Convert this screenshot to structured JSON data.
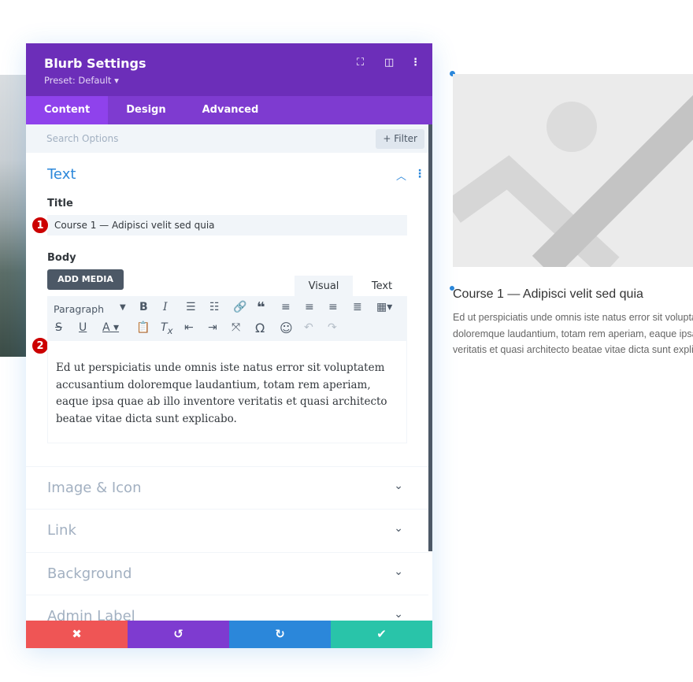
{
  "panel": {
    "title": "Blurb Settings",
    "preset": "Preset: Default ▾",
    "tabs": [
      "Content",
      "Design",
      "Advanced"
    ],
    "search_placeholder": "Search Options",
    "filter_label": "+ Filter",
    "section_title": "Text",
    "title_label": "Title",
    "title_value": "Course 1 — Adipisci velit sed quia",
    "body_label": "Body",
    "add_media": "ADD MEDIA",
    "visual_tab": "Visual",
    "text_tab": "Text",
    "format_select": "Paragraph",
    "body_text": "Ed ut perspiciatis unde omnis iste natus error sit voluptatem accusantium doloremque laudantium, totam rem aperiam, eaque ipsa quae ab illo inventore veritatis et quasi architecto beatae vitae dicta sunt explicabo.",
    "badges": [
      "1",
      "2"
    ],
    "collapsed_sections": [
      "Image & Icon",
      "Link",
      "Background",
      "Admin Label"
    ],
    "footer_colors": {
      "cancel": "#ef5555",
      "undo": "#7e3bd0",
      "redo": "#2b87da",
      "save": "#29c4a9"
    }
  },
  "preview": {
    "title": "Course 1 — Adipisci velit sed quia",
    "body_lines": [
      "Ed ut perspiciatis unde omnis iste natus error sit voluptatem accusantium",
      "doloremque laudantium, totam rem aperiam, eaque ipsa quae ab illo inventore",
      "veritatis et quasi architecto beatae vitae dicta sunt explicabo."
    ]
  },
  "accent": "#6c2eb9"
}
